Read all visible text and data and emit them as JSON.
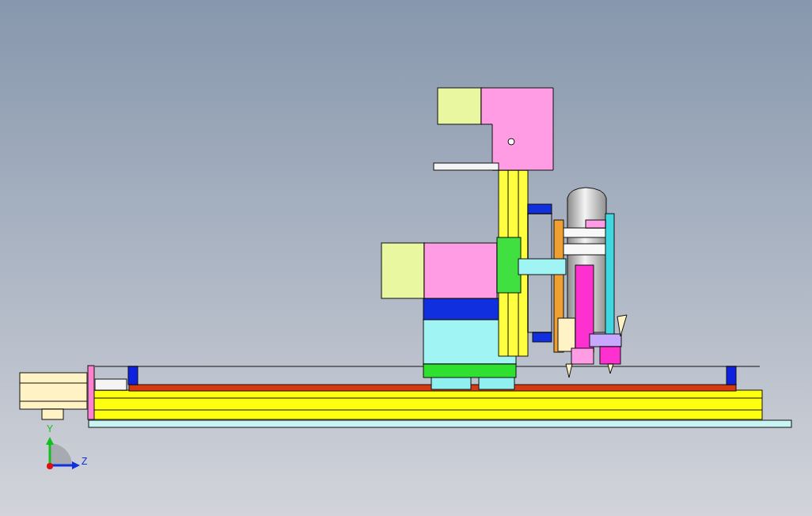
{
  "axis_triad": {
    "labels": [
      "Y",
      "Z"
    ]
  }
}
